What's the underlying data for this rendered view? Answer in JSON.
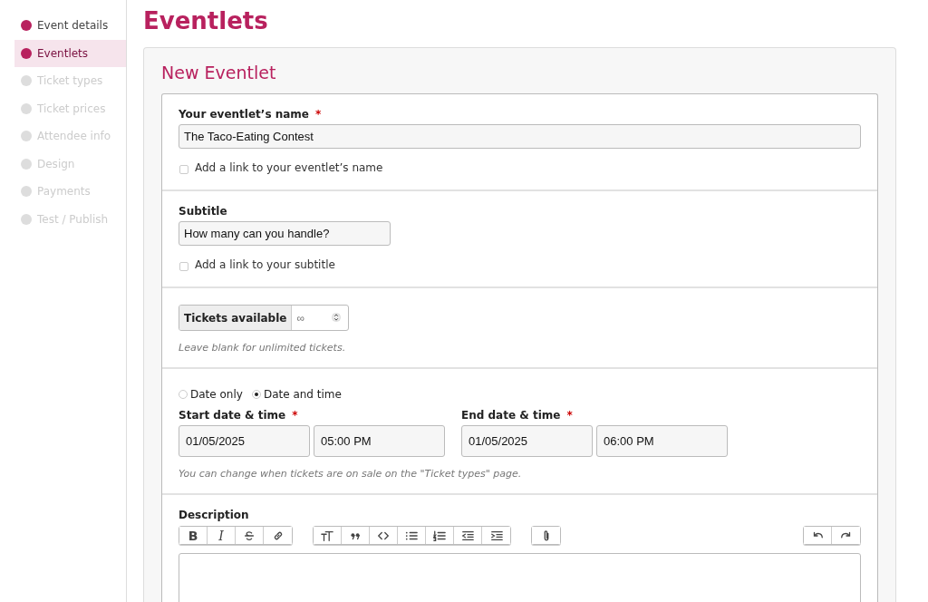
{
  "sidebar": {
    "items": [
      {
        "label": "Event details",
        "selected": false,
        "done": true
      },
      {
        "label": "Eventlets",
        "selected": true,
        "done": true
      },
      {
        "label": "Ticket types",
        "selected": false,
        "done": false
      },
      {
        "label": "Ticket prices",
        "selected": false,
        "done": false
      },
      {
        "label": "Attendee info",
        "selected": false,
        "done": false
      },
      {
        "label": "Design",
        "selected": false,
        "done": false
      },
      {
        "label": "Payments",
        "selected": false,
        "done": false
      },
      {
        "label": "Test / Publish",
        "selected": false,
        "done": false
      }
    ]
  },
  "page_title": "Eventlets",
  "form": {
    "title": "New Eventlet",
    "name": {
      "label": "Your eventlet’s name",
      "required": "*",
      "value": "The Taco-Eating Contest",
      "link_option": {
        "label": "Add a link to your eventlet’s name",
        "checked": false
      }
    },
    "subtitle": {
      "label": "Subtitle",
      "value": "How many can you handle?",
      "link_option": {
        "label": "Add a link to your subtitle",
        "checked": false
      }
    },
    "tickets": {
      "label": "Tickets available",
      "placeholder": "∞",
      "hint": "Leave blank for unlimited tickets."
    },
    "dates": {
      "modes": [
        {
          "label": "Date only",
          "selected": false
        },
        {
          "label": "Date and time",
          "selected": true
        }
      ],
      "start": {
        "label": "Start date & time",
        "required": "*",
        "date": "01/05/2025",
        "time": "05:00 PM"
      },
      "end": {
        "label": "End date & time",
        "required": "*",
        "date": "01/05/2025",
        "time": "06:00 PM"
      },
      "hint": "You can change when tickets are on sale on the \"Ticket types\" page."
    },
    "description": {
      "label": "Description",
      "bold_key": "B",
      "italic_key": "I"
    }
  }
}
